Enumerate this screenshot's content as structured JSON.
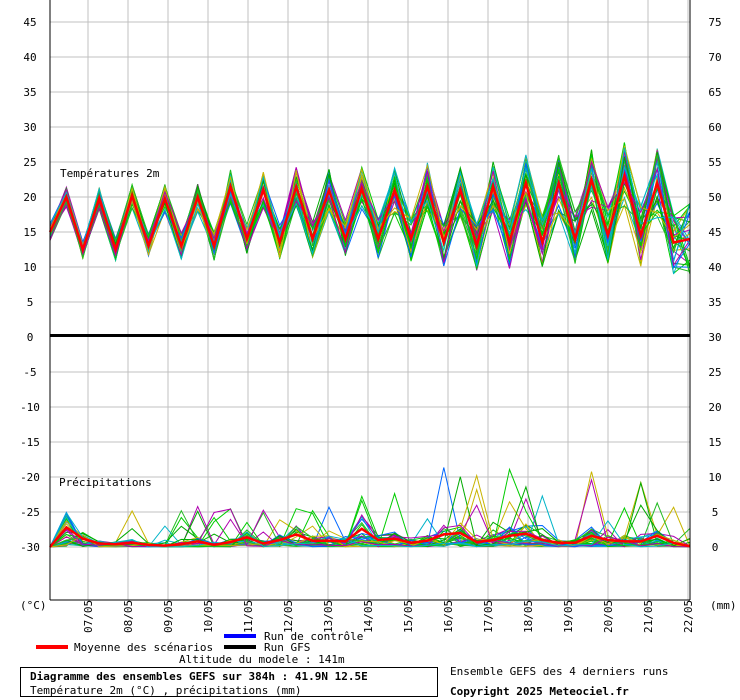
{
  "chart_data": [
    {
      "type": "line",
      "title": "Températures 2m",
      "y_left_ticks": [
        45,
        40,
        35,
        30,
        25,
        20,
        15,
        10,
        5,
        0
      ],
      "y_right_ticks": [
        75,
        70,
        65,
        60,
        55,
        50,
        45,
        40,
        35,
        30
      ],
      "ylim": [
        0,
        45
      ],
      "x_labels": [
        "07/05",
        "08/05",
        "09/05",
        "10/05",
        "11/05",
        "12/05",
        "13/05",
        "14/05",
        "15/05",
        "16/05",
        "17/05",
        "18/05",
        "19/05",
        "20/05",
        "21/05",
        "22/05"
      ],
      "series": [
        {
          "name": "Moyenne des scénarios",
          "values": [
            15.0,
            20.0,
            12.5,
            19.8,
            12.5,
            20.2,
            13.0,
            19.8,
            13.0,
            20.0,
            13.0,
            21.5,
            14.0,
            21.0,
            13.5,
            21.5,
            14.0,
            21.0,
            14.0,
            21.2,
            14.0,
            21.0,
            14.0,
            21.5,
            13.5,
            21.0,
            13.0,
            21.5,
            13.5,
            22.0,
            13.5,
            22.0,
            14.0,
            22.5,
            14.5,
            23.0,
            14.5,
            22.0,
            13.5,
            14.0
          ]
        }
      ]
    },
    {
      "type": "line",
      "title": "Précipitations",
      "y_left_ticks": [
        -5,
        -10,
        -15,
        -20,
        -25,
        -30
      ],
      "y_right_ticks": [
        30,
        25,
        20,
        15,
        10,
        5,
        0
      ],
      "ylim": [
        0,
        30
      ],
      "x_labels": [
        "07/05",
        "08/05",
        "09/05",
        "10/05",
        "11/05",
        "12/05",
        "13/05",
        "14/05",
        "15/05",
        "16/05",
        "17/05",
        "18/05",
        "19/05",
        "20/05",
        "21/05",
        "22/05"
      ],
      "series": [
        {
          "name": "Moyenne des scénarios",
          "values": [
            0.0,
            2.8,
            1.2,
            0.5,
            0.4,
            0.6,
            0.3,
            0.2,
            0.4,
            0.8,
            0.3,
            0.7,
            1.4,
            0.5,
            1.0,
            1.8,
            0.9,
            0.9,
            0.8,
            2.6,
            1.0,
            1.2,
            0.6,
            0.9,
            1.8,
            2.0,
            0.7,
            1.0,
            1.6,
            1.9,
            1.0,
            0.6,
            0.6,
            1.6,
            1.0,
            0.8,
            0.8,
            1.6,
            0.6,
            0.1
          ]
        }
      ]
    }
  ],
  "labels": {
    "left_unit": "(°C)",
    "right_unit": "(mm)",
    "legend_control": "Run de contrôle",
    "legend_mean": "Moyenne des scénarios",
    "legend_gfs": "Run GFS",
    "altitude": "Altitude du modele : 141m",
    "diagram_title": "Diagramme des ensembles GEFS sur 384h : 41.9N 12.5E",
    "diagram_subtitle": "Température 2m (°C) , précipitations (mm)",
    "ensemble_note": "Ensemble GEFS des 4 derniers runs",
    "copyright": "Copyright 2025 Meteociel.fr"
  },
  "colors": {
    "mean": "#ff0000",
    "control": "#0000ff",
    "gfs": "#000000",
    "members": [
      "#00aa00",
      "#00cc00",
      "#22bb22",
      "#c8b400",
      "#b000b0",
      "#00b4c8",
      "#0066ff"
    ],
    "grid": "#c0c0c0"
  }
}
